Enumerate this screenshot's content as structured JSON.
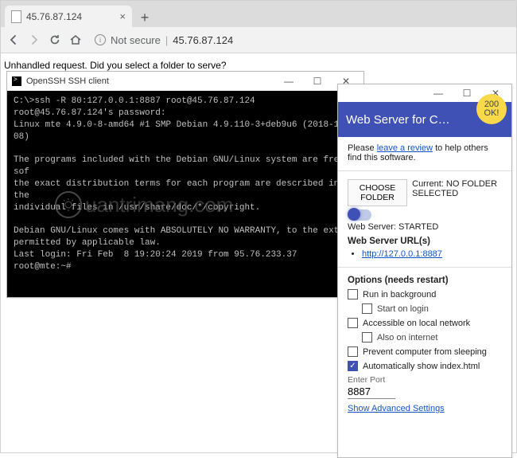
{
  "browser": {
    "tab_title": "45.76.87.124",
    "not_secure": "Not secure",
    "url": "45.76.87.124"
  },
  "page": {
    "body_text": "Unhandled request. Did you select a folder to serve?"
  },
  "terminal": {
    "title": "OpenSSH SSH client",
    "content": "C:\\>ssh -R 80:127.0.0.1:8887 root@45.76.87.124\nroot@45.76.87.124's password:\nLinux mte 4.9.0-8-amd64 #1 SMP Debian 4.9.110-3+deb9u6 (2018-10-08)\n\nThe programs included with the Debian GNU/Linux system are free sof\nthe exact distribution terms for each program are described in the\nindividual files in /usr/share/doc/*/copyright.\n\nDebian GNU/Linux comes with ABSOLUTELY NO WARRANTY, to the extent\npermitted by applicable law.\nLast login: Fri Feb  8 19:20:24 2019 from 95.76.233.37\nroot@mte:~#"
  },
  "app": {
    "title": "Web Server for C…",
    "badge_top": "200",
    "badge_bot": "OK!",
    "review_pre": "Please ",
    "review_link": "leave a review",
    "review_post": " to help others find this software.",
    "choose_btn": "CHOOSE FOLDER",
    "current_label": "Current: NO FOLDER SELECTED",
    "server_state": "Web Server: STARTED",
    "urls_heading": "Web Server URL(s)",
    "url0": "http://127.0.0.1:8887",
    "options_heading": "Options (needs restart)",
    "opts": {
      "run_bg": "Run in background",
      "start_login": "Start on login",
      "local_net": "Accessible on local network",
      "internet": "Also on internet",
      "nosleep": "Prevent computer from sleeping",
      "autoindex": "Automatically show index.html"
    },
    "port_label": "Enter Port",
    "port_value": "8887",
    "adv": "Show Advanced Settings"
  },
  "watermark": "uantrimang.com"
}
